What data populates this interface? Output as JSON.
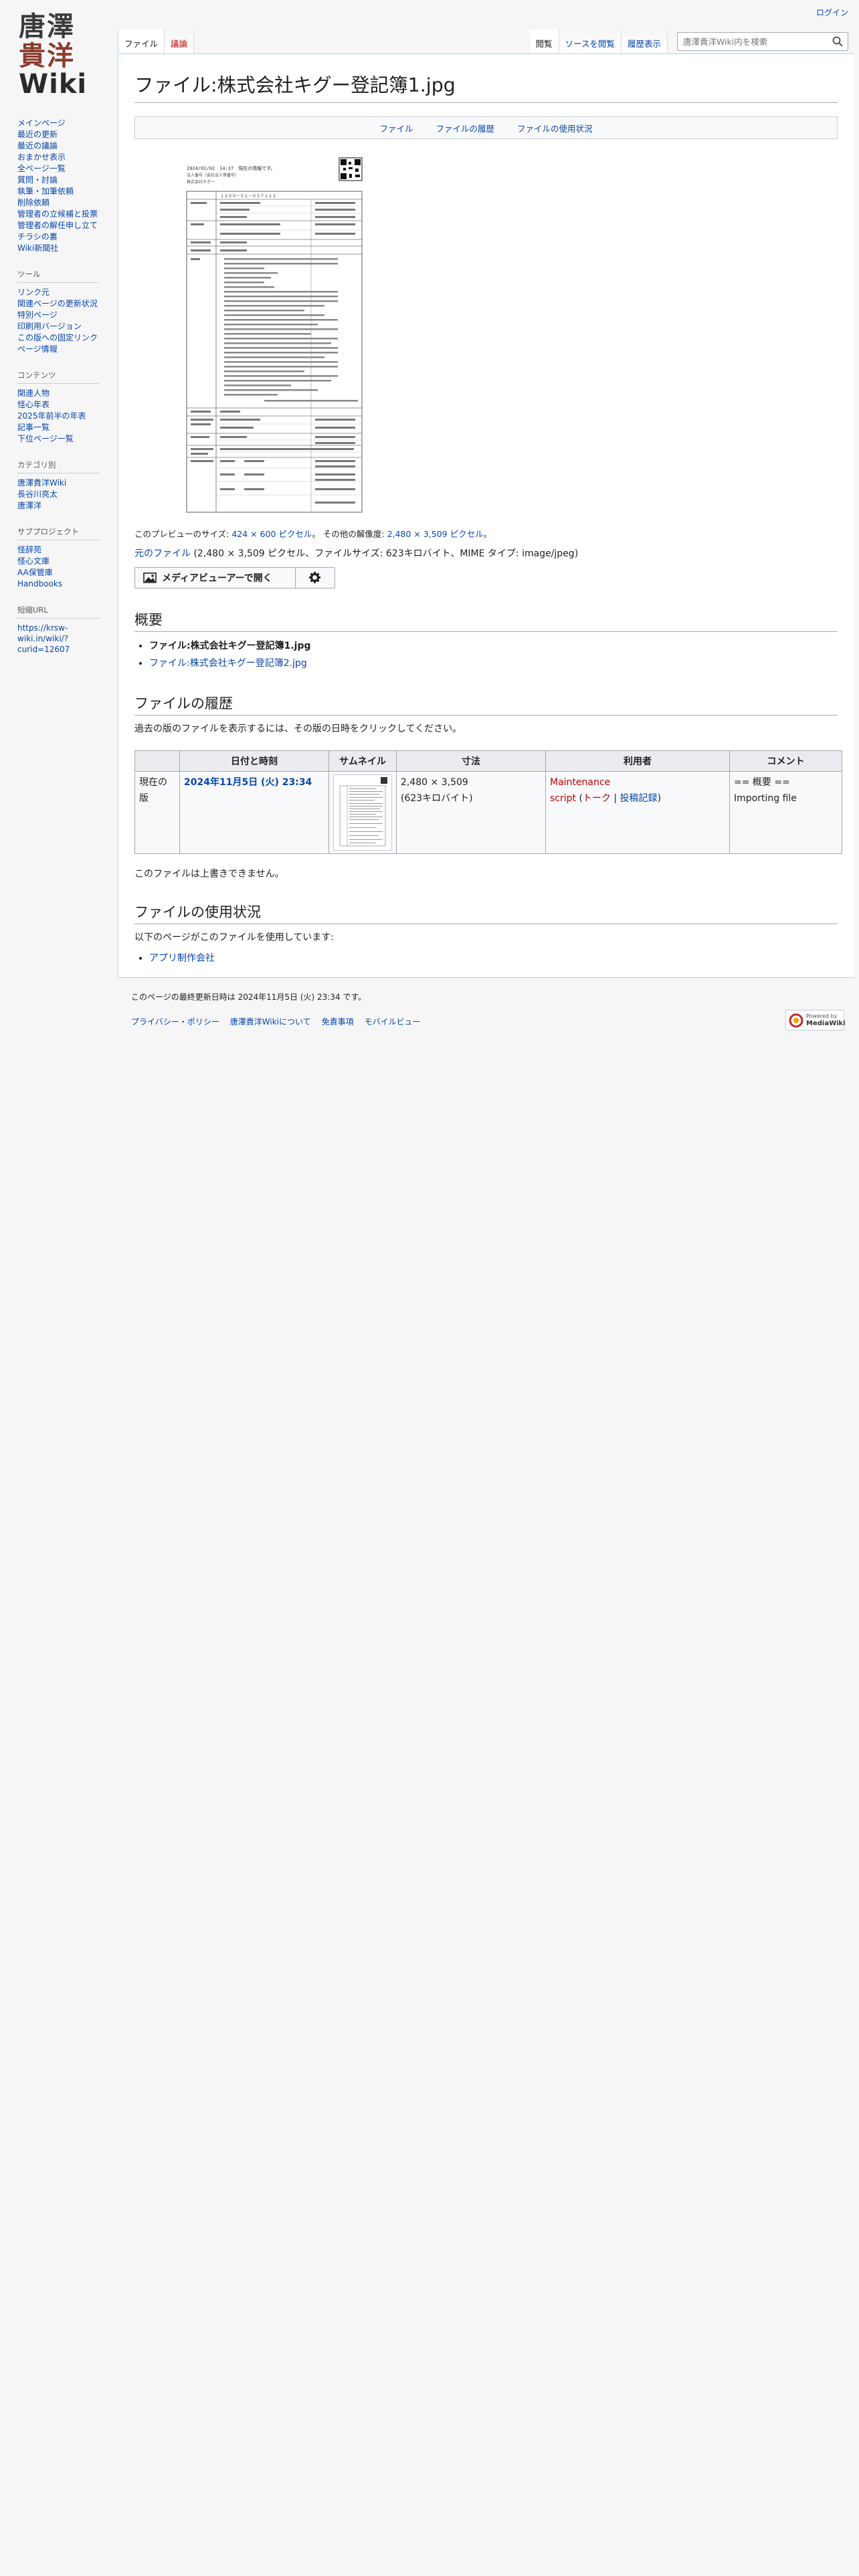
{
  "personal": {
    "login": "ログイン"
  },
  "logo": {
    "line1": "唐澤",
    "line2": "貴洋",
    "line3": "Wiki"
  },
  "sidebar": {
    "navigation": [
      "メインページ",
      "最近の更新",
      "最近の議論",
      "おまかせ表示",
      "全ページ一覧",
      "質問・討論",
      "執筆・加筆依頼",
      "削除依頼",
      "管理者の立候補と投票",
      "管理者の解任申し立て",
      "チラシの裏",
      "Wiki新聞社"
    ],
    "tools_heading": "ツール",
    "tools": [
      "リンク元",
      "関連ページの更新状況",
      "特別ページ",
      "印刷用バージョン",
      "この版への固定リンク",
      "ページ情報"
    ],
    "contents_heading": "コンテンツ",
    "contents": [
      "関連人物",
      "怪心年表",
      "2025年前半の年表",
      "記事一覧",
      "下位ページ一覧"
    ],
    "categories_heading": "カテゴリ別",
    "categories": [
      "唐澤貴洋Wiki",
      "長谷川亮太",
      "唐澤洋"
    ],
    "subprojects_heading": "サブプロジェクト",
    "subprojects": [
      "怪辞苑",
      "怪心文庫",
      "AA保管庫",
      "Handbooks"
    ],
    "shorturl_heading": "短縮URL",
    "shorturl_line1": "https://krsw-",
    "shorturl_line2": "wiki.in/wiki/?",
    "shorturl_line3": "curid=12607"
  },
  "tabs": {
    "file": "ファイル",
    "talk": "議論",
    "read": "閲覧",
    "view_source": "ソースを閲覧",
    "history": "履歴表示"
  },
  "search": {
    "placeholder": "唐澤貴洋Wiki内を検索"
  },
  "page": {
    "title": "ファイル:株式会社キグー登記簿1.jpg",
    "toc": [
      "ファイル",
      "ファイルの履歴",
      "ファイルの使用状況"
    ],
    "preview_size_prefix": "このプレビューのサイズ: ",
    "preview_size_link": "424 × 600 ピクセル",
    "preview_other": "。 その他の解像度: ",
    "other_res_link": "2,480 × 3,509 ピクセル",
    "period": "。",
    "original_link": "元のファイル",
    "original_info": " (2,480 × 3,509 ピクセル、ファイルサイズ: 623キロバイト、MIME タイプ: image/jpeg)",
    "mediaviewer_button": "メディアビューアーで開く",
    "summary_heading": "概要",
    "summary_items": [
      "ファイル:株式会社キグー登記簿1.jpg",
      "ファイル:株式会社キグー登記簿2.jpg"
    ],
    "history_heading": "ファイルの履歴",
    "history_intro": "過去の版のファイルを表示するには、その版の日時をクリックしてください。",
    "history_table": {
      "headers": [
        "",
        "日付と時刻",
        "サムネイル",
        "寸法",
        "利用者",
        "コメント"
      ],
      "row": {
        "status": "現在の版",
        "datetime": "2024年11月5日 (火) 23:34",
        "dimensions": "2,480 × 3,509",
        "size": "(623キロバイト)",
        "user_line1": "Maintenance",
        "user_line2": "script",
        "user_talk": "トーク",
        "user_sep": " | ",
        "user_contribs": "投稿記録",
        "comment": "== 概要 == Importing file"
      }
    },
    "cannot_overwrite": "このファイルは上書きできません。",
    "usage_heading": "ファイルの使用状況",
    "usage_intro": "以下のページがこのファイルを使用しています:",
    "usage_items": [
      "アプリ制作会社"
    ]
  },
  "document_preview": {
    "header_line1": "2024/01/02　14:37　現在の情報です。",
    "header_line2": "法人番号（会社法人等番号）",
    "header_line3": "株式会社キグー",
    "company_number": "１２００－０１－０５７１１２"
  },
  "footer": {
    "lastmod": "このページの最終更新日時は 2024年11月5日 (火) 23:34 です。",
    "links": [
      "プライバシー・ポリシー",
      "唐澤貴洋Wikiについて",
      "免責事項",
      "モバイルビュー"
    ],
    "badge_line1": "Powered by",
    "badge_line2": "MediaWiki"
  },
  "colors": {
    "link": "#0645ad",
    "redlink": "#ba0000",
    "border": "#a7d7f9"
  }
}
